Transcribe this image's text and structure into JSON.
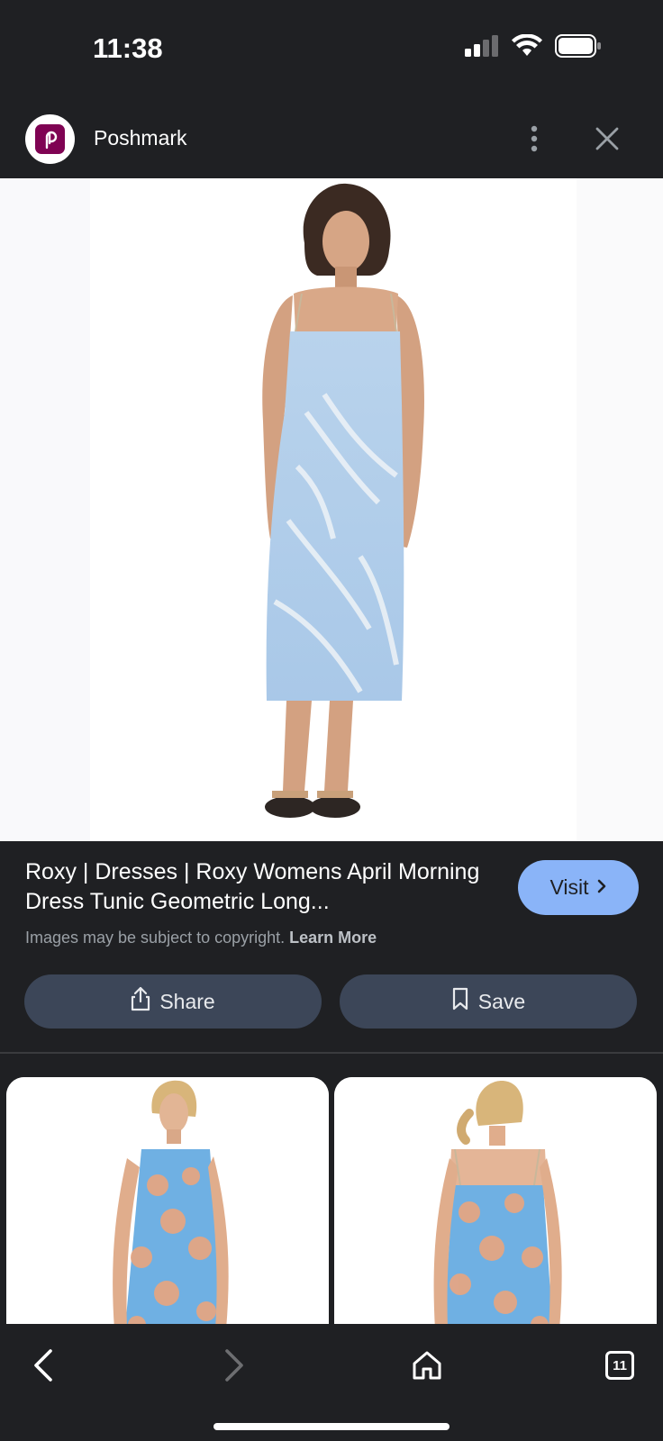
{
  "status_bar": {
    "time": "11:38",
    "icons": [
      "signal-icon",
      "wifi-icon",
      "battery-icon"
    ]
  },
  "header": {
    "site_name": "Poshmark",
    "logo_icon": "poshmark-logo",
    "more_icon": "more-vert-icon",
    "close_icon": "close-icon"
  },
  "result": {
    "title": "Roxy | Dresses | Roxy Womens April Morning Dress Tunic Geometric Long...",
    "copyright_text": "Images may be subject to copyright.",
    "learn_more": "Learn More",
    "visit_label": "Visit",
    "share_label": "Share",
    "save_label": "Save"
  },
  "colors": {
    "background": "#1f2023",
    "visit_button": "#8ab4f8",
    "action_button": "#3c4658",
    "brand": "#7f0353"
  },
  "toolbar": {
    "tab_count": "11",
    "icons": [
      "back-icon",
      "forward-icon",
      "home-icon",
      "tabs-icon"
    ]
  }
}
